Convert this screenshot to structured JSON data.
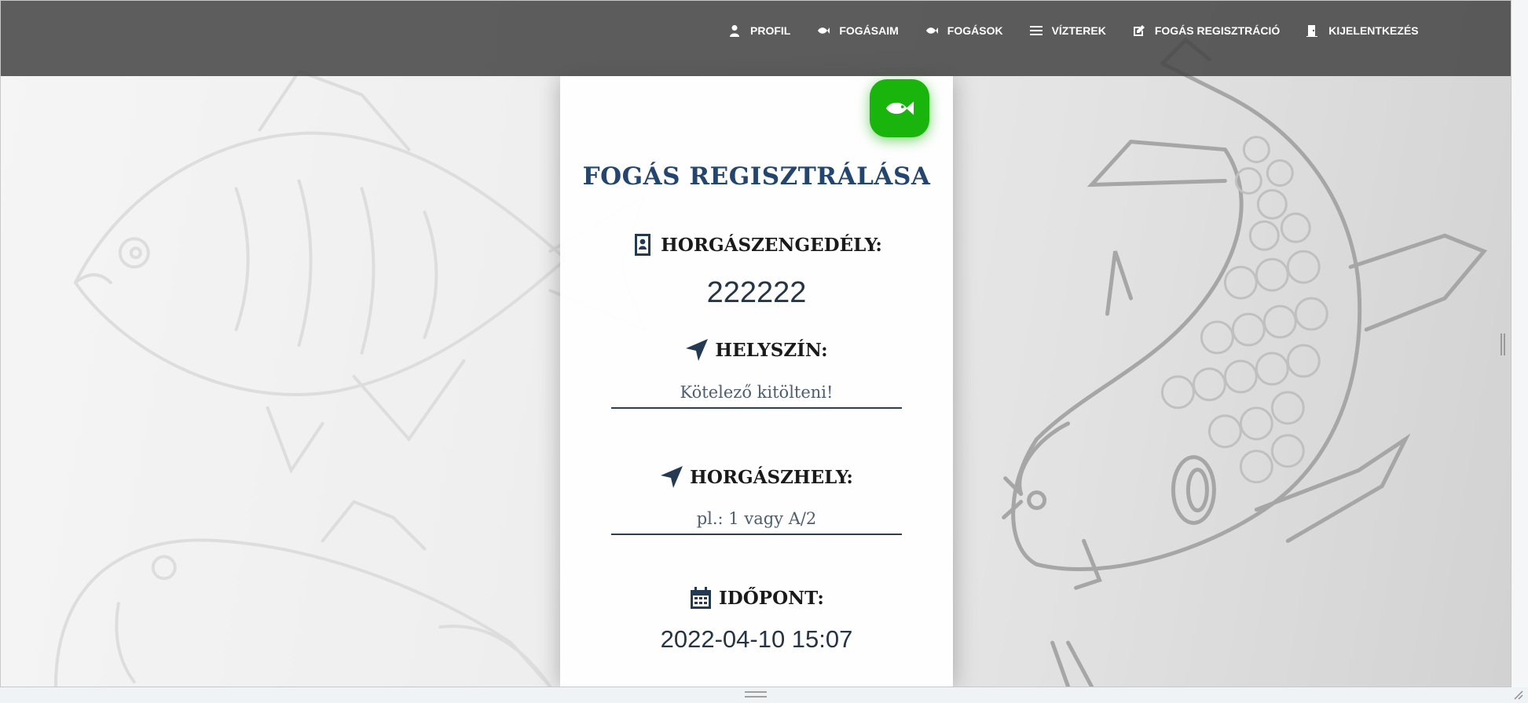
{
  "nav": {
    "items": [
      {
        "label": "PROFIL",
        "icon": "user-icon"
      },
      {
        "label": "FOGÁSAIM",
        "icon": "fish-icon"
      },
      {
        "label": "FOGÁSOK",
        "icon": "fish-icon"
      },
      {
        "label": "VÍZTEREK",
        "icon": "water-icon"
      },
      {
        "label": "FOGÁS REGISZTRÁCIÓ",
        "icon": "edit-icon"
      },
      {
        "label": "KIJELENTKEZÉS",
        "icon": "door-icon"
      }
    ]
  },
  "form": {
    "title": "FOGÁS REGISZTRÁLÁSA",
    "permit_label": "HORGÁSZENGEDÉLY:",
    "permit_value": "222222",
    "location_label": "HELYSZÍN:",
    "location_placeholder": "Kötelező kitölteni!",
    "spot_label": "HORGÁSZHELY:",
    "spot_placeholder": "pl.: 1 vagy A/2",
    "time_label": "IDŐPONT:",
    "time_value": "2022-04-10 15:07"
  },
  "colors": {
    "accent": "#19b40c",
    "navbar": "#484848",
    "title": "#24466e",
    "text": "#1a1a1a"
  }
}
